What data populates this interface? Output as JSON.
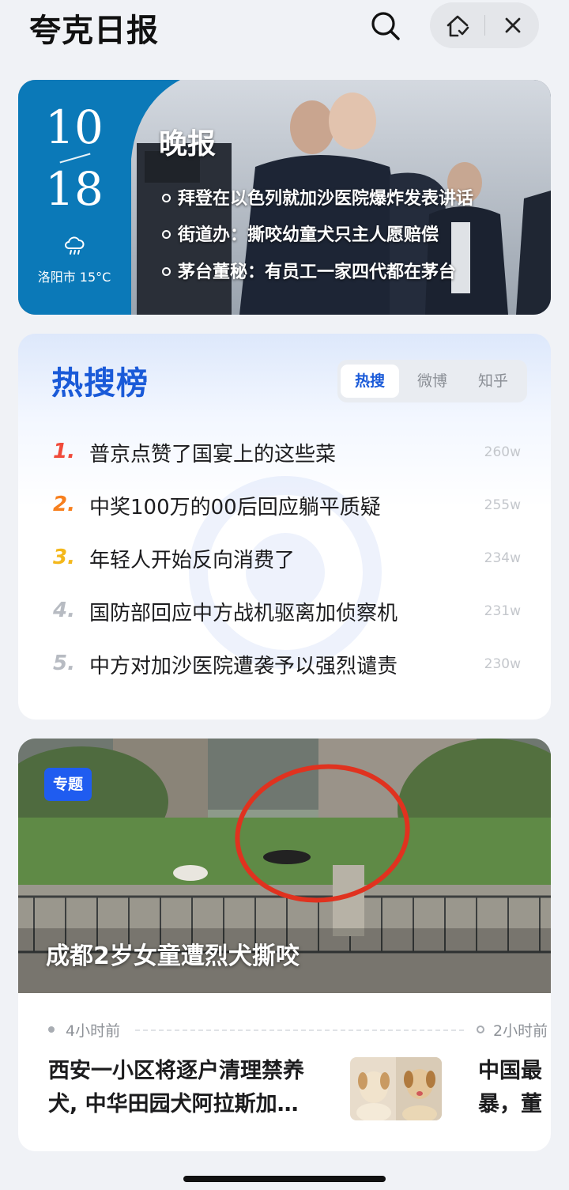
{
  "app": {
    "title": "夸克日报"
  },
  "topbar": {
    "search_icon": "search-icon",
    "home_icon": "home-check-icon",
    "close_icon": "close-icon"
  },
  "report": {
    "month": "10",
    "day": "18",
    "weather_icon": "cloud-rain-icon",
    "weather": "洛阳市 15°C",
    "label": "晚报",
    "headlines": [
      "拜登在以色列就加沙医院爆炸发表讲话",
      "街道办：撕咬幼童犬只主人愿赔偿",
      "茅台董秘：有员工一家四代都在茅台"
    ],
    "colors": {
      "panel": "#0b79b8"
    }
  },
  "hot": {
    "title": "热搜榜",
    "tabs": [
      "热搜",
      "微博",
      "知乎"
    ],
    "active_tab": 0,
    "items": [
      {
        "rank": "1.",
        "text": "普京点赞了国宴上的这些菜",
        "count": "260w",
        "color": "#f04a3a"
      },
      {
        "rank": "2.",
        "text": "中奖100万的00后回应躺平质疑",
        "count": "255w",
        "color": "#f77f1e"
      },
      {
        "rank": "3.",
        "text": "年轻人开始反向消费了",
        "count": "234w",
        "color": "#f4b81c"
      },
      {
        "rank": "4.",
        "text": "国防部回应中方战机驱离加侦察机",
        "count": "231w",
        "color": "#b7bbc2"
      },
      {
        "rank": "5.",
        "text": "中方对加沙医院遭袭予以强烈谴责",
        "count": "230w",
        "color": "#b7bbc2"
      }
    ]
  },
  "topic": {
    "badge": "专题",
    "title": "成都2岁女童遭烈犬撕咬",
    "timeline": [
      {
        "time": "4小时前",
        "title_line1": "西安一小区将逐户清理禁养",
        "title_line2": "犬, 中华田园犬阿拉斯加…"
      },
      {
        "time": "2小时前",
        "title_line1": "中国最",
        "title_line2": "暴，董"
      }
    ]
  }
}
